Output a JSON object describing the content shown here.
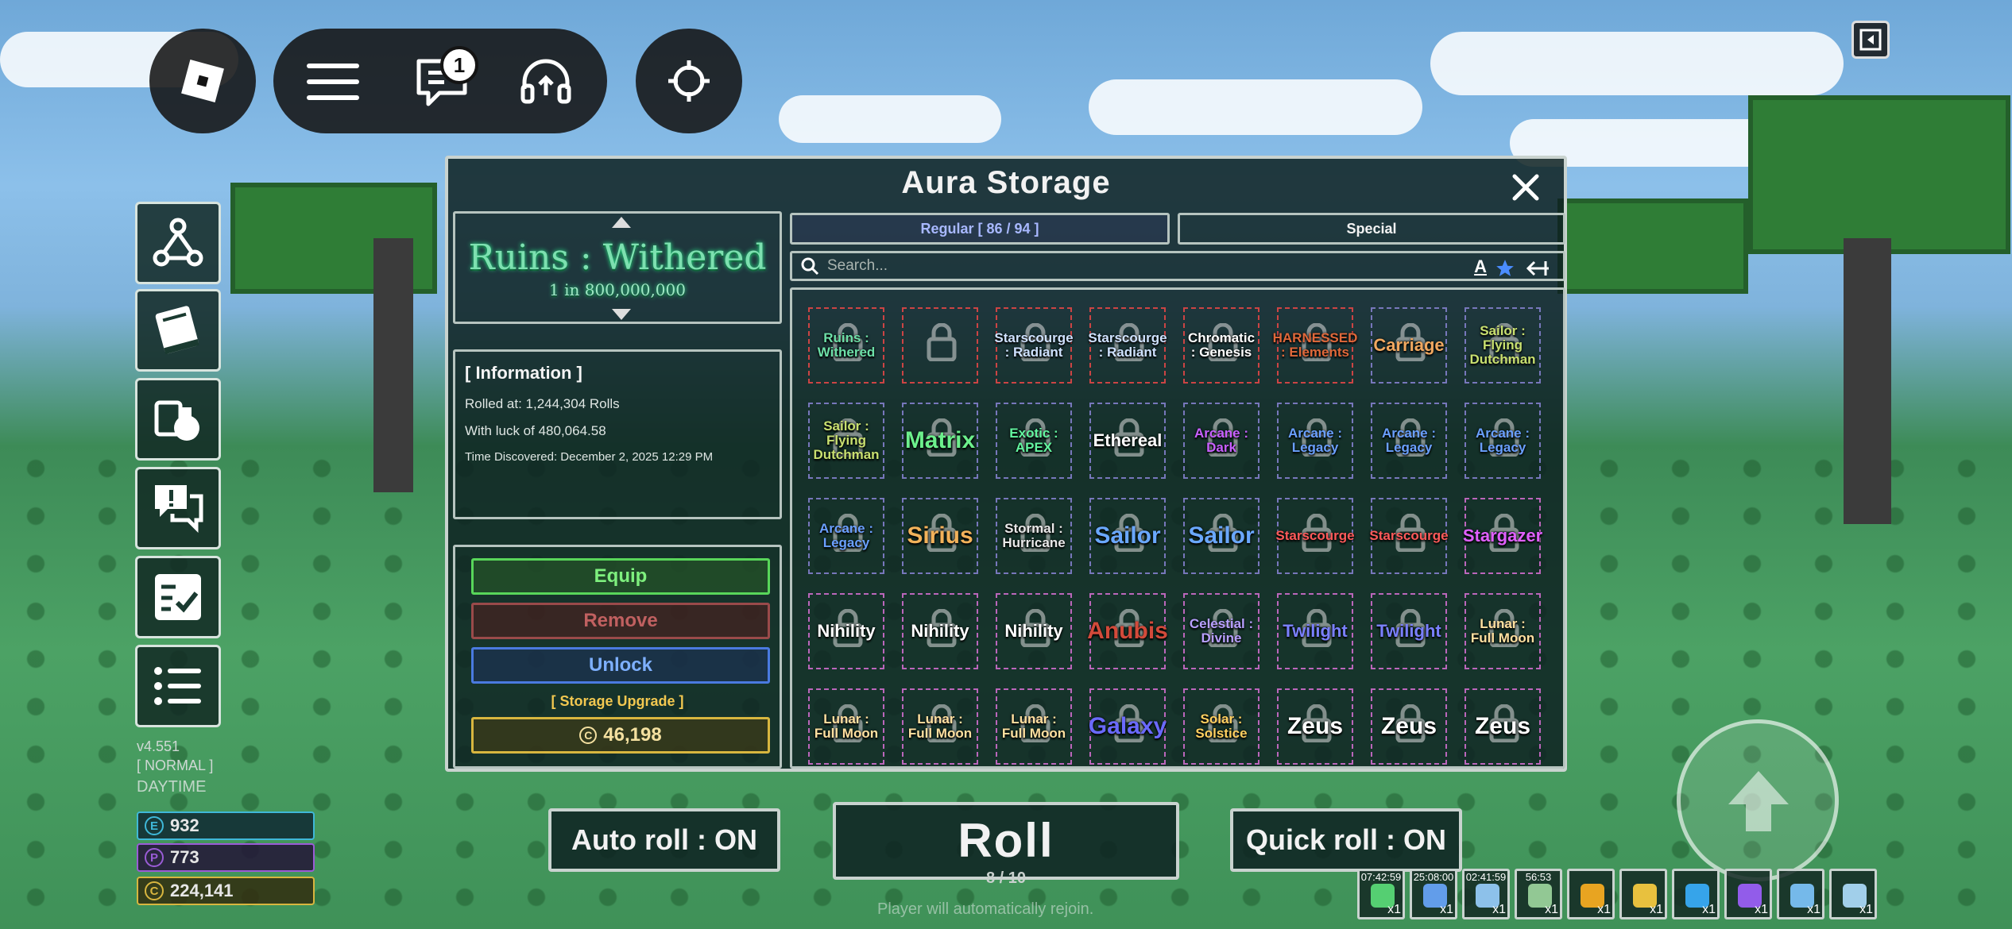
{
  "topbar": {
    "chat_badge": "1"
  },
  "version": {
    "version": "v4.551",
    "mode": "[ NORMAL ]",
    "time": "DAYTIME"
  },
  "currencies": [
    {
      "icon": "E",
      "value": "932",
      "color": "#3fb8d8"
    },
    {
      "icon": "P",
      "value": "773",
      "color": "#9a5cd6"
    },
    {
      "icon": "C",
      "value": "224,141",
      "color": "#d8b63f"
    }
  ],
  "panel": {
    "title": "Aura Storage",
    "preview": {
      "name": "Ruins : Withered",
      "odds": "1 in 800,000,000"
    },
    "info": {
      "title": "[ Information ]",
      "rolled_at": "Rolled at: 1,244,304 Rolls",
      "luck": "With luck of 480,064.58",
      "discovered": "Time Discovered: December 2, 2025 12:29 PM"
    },
    "actions": {
      "equip": "Equip",
      "remove": "Remove",
      "unlock": "Unlock",
      "upgrade_label": "[ Storage Upgrade ]",
      "upgrade_price": "46,198"
    },
    "tabs": {
      "regular": "Regular [ 86 / 94 ]",
      "special": "Special"
    },
    "search": {
      "placeholder": "Search..."
    },
    "sort_letter": "A",
    "auras": [
      {
        "name": "Ruins : Withered",
        "color": "#6de0a8",
        "border": "#c44"
      },
      {
        "name": "",
        "color": "#e34848",
        "border": "#c44"
      },
      {
        "name": "Starscourge : Radiant",
        "color": "#cfe2ff",
        "border": "#c44"
      },
      {
        "name": "Starscourge : Radiant",
        "color": "#cfe2ff",
        "border": "#c44"
      },
      {
        "name": "Chromatic : Genesis",
        "color": "#ffffff",
        "border": "#c44"
      },
      {
        "name": "HARNESSED : Elements",
        "color": "#e0683a",
        "border": "#c44"
      },
      {
        "name": "Carriage",
        "color": "#f0a860",
        "border": "#77b"
      },
      {
        "name": "Sailor : Flying Dutchman",
        "color": "#c8e070",
        "border": "#77b"
      },
      {
        "name": "Sailor : Flying Dutchman",
        "color": "#c8e070",
        "border": "#77b"
      },
      {
        "name": "Matrix",
        "color": "#6cf08c",
        "border": "#77b"
      },
      {
        "name": "Exotic : APEX",
        "color": "#63f5a0",
        "border": "#77b"
      },
      {
        "name": "Ethereal",
        "color": "#ffffff",
        "border": "#77b"
      },
      {
        "name": "Arcane : Dark",
        "color": "#c860ff",
        "border": "#77b"
      },
      {
        "name": "Arcane : Legacy",
        "color": "#6aa0ff",
        "border": "#77b"
      },
      {
        "name": "Arcane : Legacy",
        "color": "#6aa0ff",
        "border": "#77b"
      },
      {
        "name": "Arcane : Legacy",
        "color": "#6aa0ff",
        "border": "#77b"
      },
      {
        "name": "Arcane : Legacy",
        "color": "#6aa0ff",
        "border": "#77b"
      },
      {
        "name": "Sirius",
        "color": "#f2b25a",
        "border": "#77b"
      },
      {
        "name": "Stormal : Hurricane",
        "color": "#e8e8e8",
        "border": "#77b"
      },
      {
        "name": "Sailor",
        "color": "#6aa8ff",
        "border": "#77b"
      },
      {
        "name": "Sailor",
        "color": "#6aa8ff",
        "border": "#77b"
      },
      {
        "name": "Starscourge",
        "color": "#ff5a5a",
        "border": "#77b"
      },
      {
        "name": "Starscourge",
        "color": "#ff5a5a",
        "border": "#77b"
      },
      {
        "name": "Stargazer",
        "color": "#e060ff",
        "border": "#b6b"
      },
      {
        "name": "Nihility",
        "color": "#ffffff",
        "border": "#b6b"
      },
      {
        "name": "Nihility",
        "color": "#ffffff",
        "border": "#b6b"
      },
      {
        "name": "Nihility",
        "color": "#ffffff",
        "border": "#b6b"
      },
      {
        "name": "Anubis",
        "color": "#d24a3a",
        "border": "#b6b"
      },
      {
        "name": "Celestial : Divine",
        "color": "#b8a0ff",
        "border": "#b6b"
      },
      {
        "name": "Twilight",
        "color": "#7a80ff",
        "border": "#b6b"
      },
      {
        "name": "Twilight",
        "color": "#7a80ff",
        "border": "#b6b"
      },
      {
        "name": "Lunar : Full Moon",
        "color": "#ffe0a0",
        "border": "#b6b"
      },
      {
        "name": "Lunar : Full Moon",
        "color": "#ffe0a0",
        "border": "#b6b"
      },
      {
        "name": "Lunar : Full Moon",
        "color": "#ffe0a0",
        "border": "#b6b"
      },
      {
        "name": "Lunar : Full Moon",
        "color": "#ffe0a0",
        "border": "#b6b"
      },
      {
        "name": "Galaxy",
        "color": "#6a6aff",
        "border": "#b6b"
      },
      {
        "name": "Solar : Solstice",
        "color": "#ffd060",
        "border": "#b6b"
      },
      {
        "name": "Zeus",
        "color": "#ffffff",
        "border": "#b6b"
      },
      {
        "name": "Zeus",
        "color": "#ffffff",
        "border": "#b6b"
      },
      {
        "name": "Zeus",
        "color": "#ffffff",
        "border": "#b6b"
      }
    ]
  },
  "controls": {
    "auto_roll": "Auto roll : ON",
    "roll": "Roll",
    "roll_count": "8 / 10",
    "quick_roll": "Quick roll : ON",
    "notice": "Player will automatically rejoin."
  },
  "boosts": [
    {
      "time": "07:42:59",
      "mult": "x1",
      "icon": "luck-plus-icon",
      "color": "#5ce07a"
    },
    {
      "time": "25:08:00",
      "mult": "x1",
      "icon": "speed-icon",
      "color": "#6aa8ff"
    },
    {
      "time": "02:41:59",
      "mult": "x1",
      "icon": "moon-icon",
      "color": "#9ad0ff"
    },
    {
      "time": "56:53",
      "mult": "x1",
      "icon": "potion-icon",
      "color": "#a0d8a0"
    },
    {
      "time": "",
      "mult": "x1",
      "icon": "30-luck-icon",
      "color": "#ffb020"
    },
    {
      "time": "",
      "mult": "x1",
      "icon": "bank-icon",
      "color": "#ffd040"
    },
    {
      "time": "",
      "mult": "x1",
      "icon": "vip-plus-icon",
      "color": "#3ab0ff"
    },
    {
      "time": "",
      "mult": "x1",
      "icon": "premium-icon",
      "color": "#a060ff"
    },
    {
      "time": "",
      "mult": "x1",
      "icon": "storm-icon",
      "color": "#80c8ff"
    },
    {
      "time": "",
      "mult": "x1",
      "icon": "wind-icon",
      "color": "#b0e0ff"
    }
  ]
}
